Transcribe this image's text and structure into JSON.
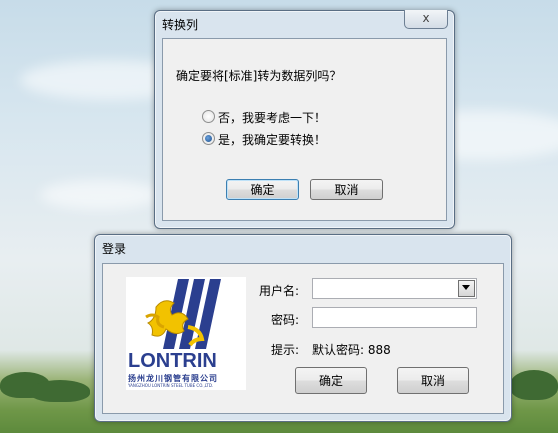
{
  "convert_dialog": {
    "title": "转换列",
    "close_label": "x",
    "question": "确定要将[标准]转为数据列吗？",
    "options": [
      {
        "label": "否，我要考虑一下！",
        "selected": false
      },
      {
        "label": "是，我确定要转换！",
        "selected": true
      }
    ],
    "ok_label": "确定",
    "cancel_label": "取消"
  },
  "login_dialog": {
    "title": "登录",
    "logo": {
      "brand": "LONTRIN",
      "company": "扬州龙川钢管有限公司",
      "company_en": "YANGZHOU LONTRIN STEEL TUBE CO.,LTD."
    },
    "username_label": "用户名:",
    "username_value": "",
    "password_label": "密码:",
    "password_value": "",
    "hint_label": "提示:",
    "hint_text": "默认密码: 888",
    "ok_label": "确定",
    "cancel_label": "取消"
  },
  "colors": {
    "accent_blue": "#2b3f8f",
    "logo_yellow": "#f2c200",
    "window_frame": "#d9e4ee"
  }
}
